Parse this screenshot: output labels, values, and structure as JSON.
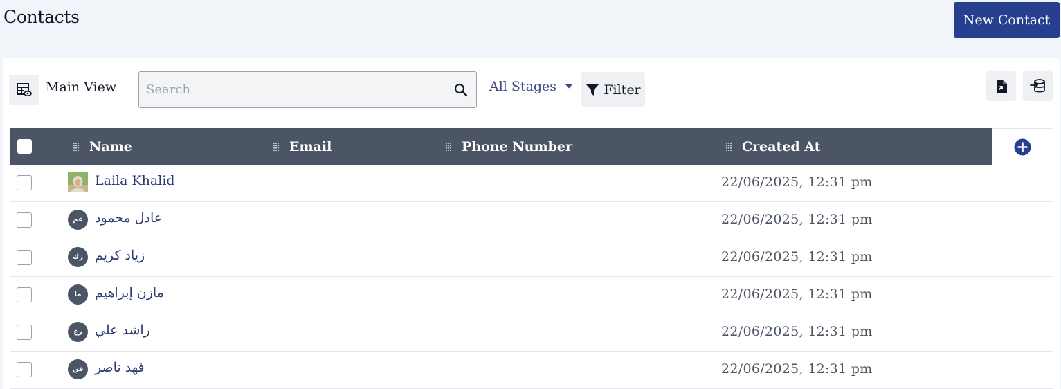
{
  "header": {
    "title": "Contacts",
    "new_contact_label": "New Contact"
  },
  "toolbar": {
    "view_label": "Main View",
    "search_placeholder": "Search",
    "stages_label": "All Stages",
    "filter_label": "Filter"
  },
  "table": {
    "columns": [
      "Name",
      "Email",
      "Phone Number",
      "Created At"
    ],
    "rows": [
      {
        "initials": "",
        "name": "Laila Khalid",
        "email": "",
        "phone": "",
        "created_at": "22/06/2025, 12:31 pm"
      },
      {
        "initials": "عم",
        "name": "عادل محمود",
        "email": "",
        "phone": "",
        "created_at": "22/06/2025, 12:31 pm"
      },
      {
        "initials": "زك",
        "name": "زياد كريم",
        "email": "",
        "phone": "",
        "created_at": "22/06/2025, 12:31 pm"
      },
      {
        "initials": "ما",
        "name": "مازن إبراهيم",
        "email": "",
        "phone": "",
        "created_at": "22/06/2025, 12:31 pm"
      },
      {
        "initials": "رع",
        "name": "راشد علي",
        "email": "",
        "phone": "",
        "created_at": "22/06/2025, 12:31 pm"
      },
      {
        "initials": "فن",
        "name": "فهد ناصر",
        "email": "",
        "phone": "",
        "created_at": "22/06/2025, 12:31 pm"
      }
    ]
  },
  "colors": {
    "brand": "#273f8f",
    "header_bg": "#4b5565",
    "link": "#2f3b73"
  }
}
